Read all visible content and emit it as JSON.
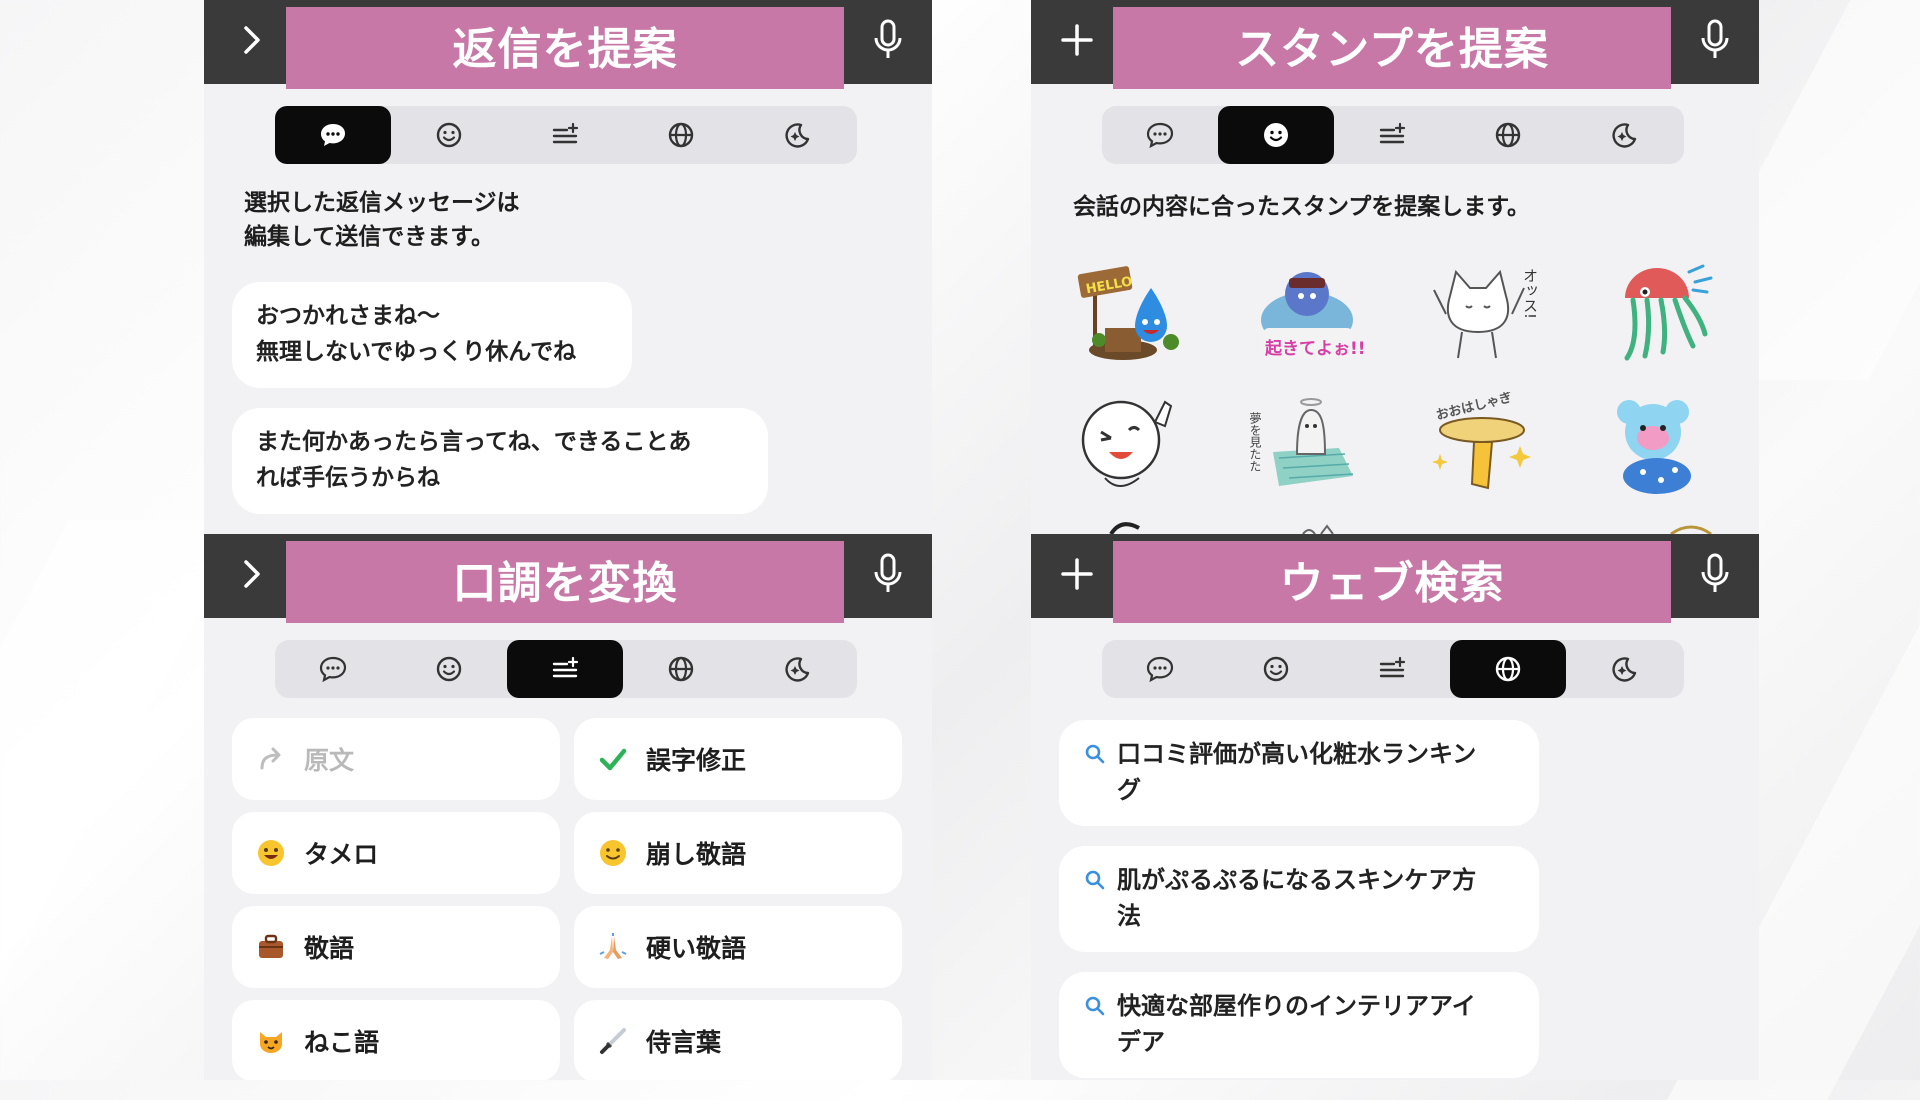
{
  "colors": {
    "banner": "#c878a7",
    "header": "#3a3a3a",
    "panel": "#f2f2f5",
    "active_tab": "#0b0b0b"
  },
  "tabs_icons": [
    "speech-bubble-icon",
    "smiley-icon",
    "tone-adjust-icon",
    "globe-icon",
    "moon-sparkle-icon"
  ],
  "reply": {
    "title": "返信を提案",
    "description": [
      "選択した返信メッセージは",
      "編集して送信できます。"
    ],
    "suggestions": [
      [
        "おつかれさまね〜",
        "無理しないでゆっくり休んでね"
      ],
      [
        "また何かあったら言ってね、できることあ",
        "れば手伝うからね"
      ]
    ]
  },
  "stamp": {
    "title": "スタンプを提案",
    "description": "会話の内容に合ったスタンプを提案します。",
    "stickers": [
      "hello-sign-slime-sticker",
      "octopus-wake-up-sticker",
      "cat-ossu-sticker",
      "jellyfish-sticker",
      "moon-face-sticker",
      "ghost-bath-sticker",
      "hand-plate-sticker",
      "pink-koala-sticker"
    ],
    "sticker_text": {
      "hello": "HELLO",
      "okiteyo": "起きてよぉ!!",
      "ossu": "オッス!",
      "ohayo": "おおはしゃぎ"
    }
  },
  "tone": {
    "title": "口調を変換",
    "options": [
      {
        "label": "原文",
        "icon": "redo-arrow-icon",
        "disabled": true
      },
      {
        "label": "誤字修正",
        "icon": "checkmark-icon",
        "disabled": false
      },
      {
        "label": "タメロ",
        "icon": "grin-face-icon",
        "disabled": false
      },
      {
        "label": "崩し敬語",
        "icon": "smile-face-icon",
        "disabled": false
      },
      {
        "label": "敬語",
        "icon": "briefcase-icon",
        "disabled": false
      },
      {
        "label": "硬い敬語",
        "icon": "praying-hands-icon",
        "disabled": false
      },
      {
        "label": "ねこ語",
        "icon": "cat-face-icon",
        "disabled": false
      },
      {
        "label": "侍言葉",
        "icon": "katana-icon",
        "disabled": false
      }
    ]
  },
  "web": {
    "title": "ウェブ検索",
    "queries": [
      [
        "口コミ評価が高い化粧水ランキン",
        "グ"
      ],
      [
        "肌がぷるぷるになるスキンケア方",
        "法"
      ],
      [
        "快適な部屋作りのインテリアアイ",
        "デア"
      ]
    ]
  }
}
